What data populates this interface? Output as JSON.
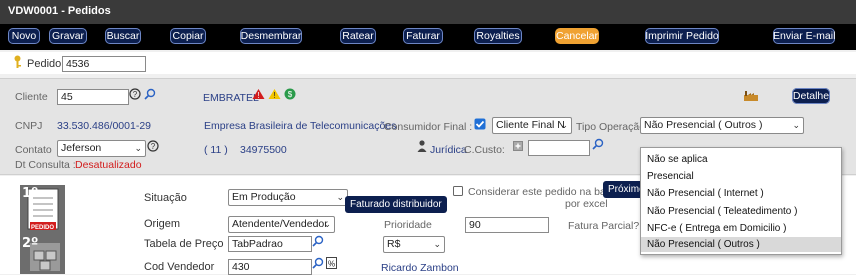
{
  "window": {
    "title": "VDW0001 - Pedidos"
  },
  "toolbar": {
    "buttons": [
      "Novo",
      "Gravar",
      "Buscar",
      "Copiar",
      "Desmembrar",
      "Ratear",
      "Faturar",
      "Royalties",
      "Cancelar",
      "Imprimir Pedido",
      "Enviar E-mail"
    ]
  },
  "pedido": {
    "label": "Pedido",
    "value": "4536"
  },
  "cliente": {
    "label": "Cliente",
    "value": "45",
    "name": "EMBRATEL",
    "detail_button": "Detalhe"
  },
  "cnpj": {
    "label": "CNPJ",
    "value": "33.530.486/0001-29",
    "company": "Empresa Brasileira de Telecomunicações"
  },
  "consumidor_final": {
    "label": "Consumidor Final :",
    "checked": true,
    "select_value": "Cliente Final N"
  },
  "tipo_operacao": {
    "label": "Tipo Operação",
    "value": "Não Presencial ( Outros )",
    "options": [
      "Não se aplica",
      "Presencial",
      "Não Presencial ( Internet )",
      "Não Presencial ( Teleatedimento )",
      "NFC-e ( Entrega em Domicilio )",
      "Não Presencial ( Outros )"
    ]
  },
  "contato": {
    "label": "Contato",
    "value": "Jeferson",
    "phone_area": "( 11 )",
    "phone": "34975500",
    "pessoa": "Jurídica",
    "custo_label": "C.Custo:"
  },
  "dt_consulta": {
    "label": "Dt Consulta :",
    "value": "Desatualizado"
  },
  "steps": {
    "step1": "1º",
    "step1_caption": "PEDIDO",
    "step2": "2º"
  },
  "situacao": {
    "label": "Situação",
    "value": "Em Produção",
    "tooltip": "Faturado distribuidor"
  },
  "considerar": {
    "text": "Considerar este pedido na baixa",
    "text2": "por excel",
    "tooltip": "Próximo"
  },
  "origem": {
    "label": "Origem",
    "value": "Atendente/Vendedor"
  },
  "prioridade": {
    "label": "Prioridade",
    "value": "90"
  },
  "fatura_parcial": {
    "label": "Fatura Parcial?"
  },
  "tabela_preco": {
    "label": "Tabela de Preço",
    "value": "TabPadrao",
    "currency": "R$"
  },
  "cod_vendedor": {
    "label": "Cod Vendedor",
    "value": "430",
    "name": "Ricardo Zambon"
  },
  "colors": {
    "toolbar_bg": "#000000",
    "button_bg": "#0c1f4f",
    "cancel_bg": "#f0a232",
    "titlebar_bg": "#3a3a3a",
    "warning_red": "#d21d1d"
  }
}
